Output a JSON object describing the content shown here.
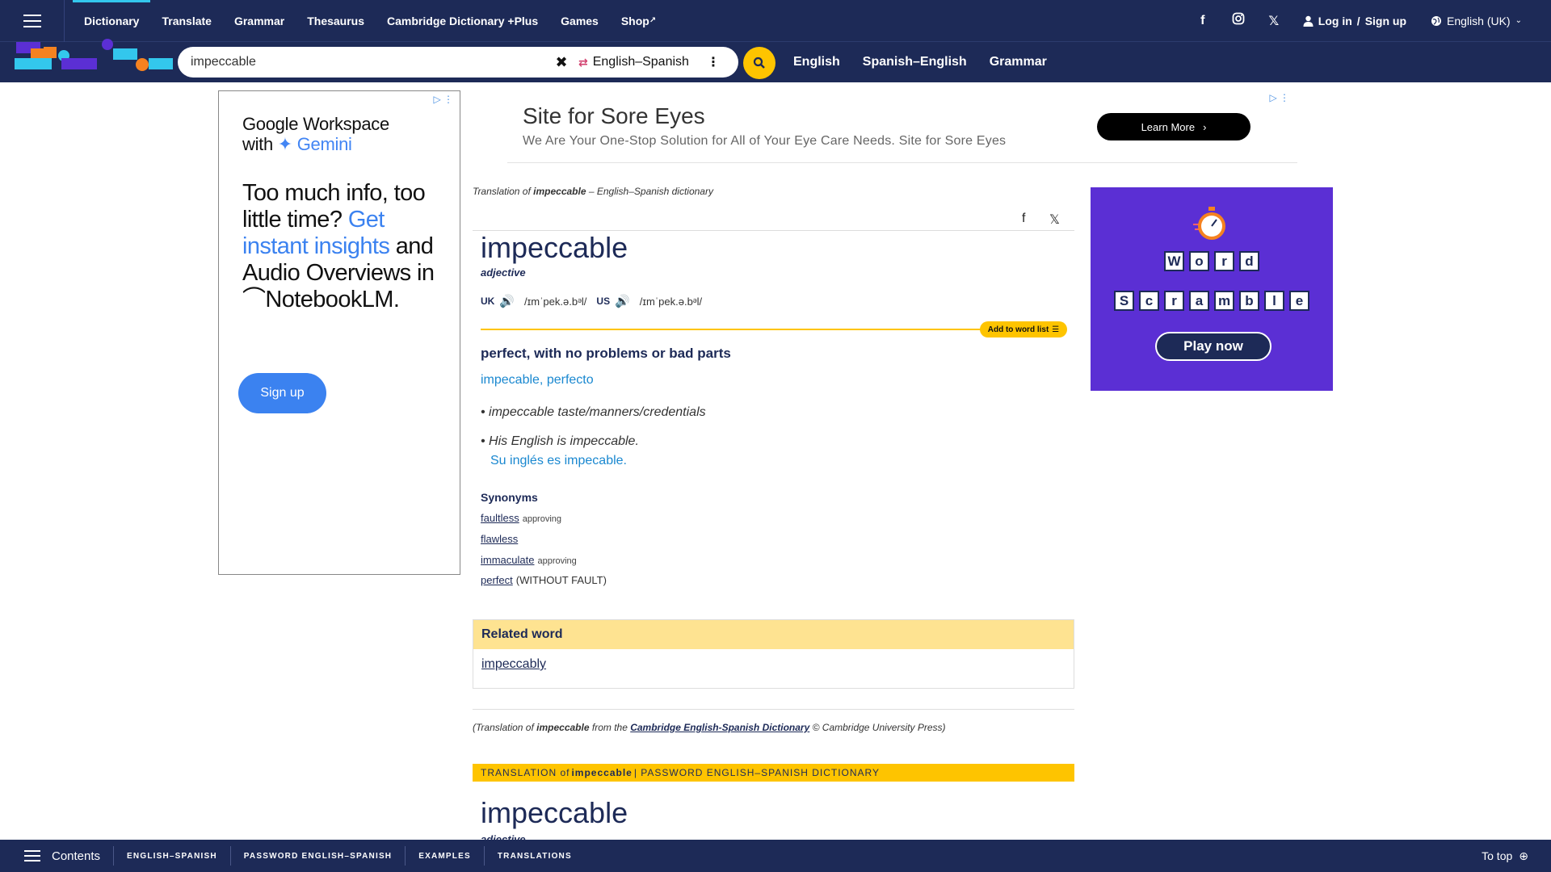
{
  "topnav": {
    "items": [
      "Dictionary",
      "Translate",
      "Grammar",
      "Thesaurus",
      "Cambridge Dictionary +Plus",
      "Games",
      "Shop"
    ],
    "login_label": "Log in",
    "signup_label": "Sign up",
    "language": "English (UK)"
  },
  "search": {
    "value": "impeccable",
    "dictionary": "English–Spanish",
    "subnav": [
      "English",
      "Spanish–English",
      "Grammar"
    ]
  },
  "ad_left": {
    "line1": "Google Workspace",
    "line2a": "with",
    "line2b": "Gemini",
    "h_a": "Too much info, too little time?",
    "h_b": "Get instant insights",
    "h_c": "and Audio Overviews in",
    "h_d": "NotebookLM.",
    "button": "Sign up"
  },
  "ad_top": {
    "title": "Site for Sore Eyes",
    "subtitle": "We Are Your One-Stop Solution for All of Your Eye Care Needs. Site for Sore Eyes",
    "button": "Learn More"
  },
  "entry": {
    "breadcrumb_pre": "Translation of ",
    "breadcrumb_word": "impeccable",
    "breadcrumb_post": " – English–Spanish dictionary",
    "headword": "impeccable",
    "pos": "adjective",
    "uk_label": "UK",
    "uk_ipa": "/ɪmˈpek.ə.bᵊl/",
    "us_label": "US",
    "us_ipa": "/ɪmˈpek.ə.bᵊl/",
    "add_to_list": "Add to word list",
    "definition": "perfect, with no problems or bad parts",
    "translation": "impecable, perfecto",
    "example1": "impeccable taste/manners/credentials",
    "example2": "His English is impeccable.",
    "example2_translation": "Su inglés es impecable.",
    "synonyms_heading": "Synonyms",
    "synonyms": [
      {
        "word": "faultless",
        "note": "approving"
      },
      {
        "word": "flawless",
        "note": ""
      },
      {
        "word": "immaculate",
        "note": "approving"
      },
      {
        "word": "perfect",
        "note": "(WITHOUT FAULT)"
      }
    ],
    "related_heading": "Related word",
    "related_word": "impeccably",
    "credit_pre": "(Translation of ",
    "credit_word": "impeccable",
    "credit_mid": " from the ",
    "credit_source": "Cambridge English-Spanish Dictionary",
    "credit_post": " © Cambridge University Press)",
    "pw_pre": "TRANSLATION of ",
    "pw_word": "impeccable",
    "pw_post": " | PASSWORD ENGLISH–SPANISH DICTIONARY",
    "headword2": "impeccable",
    "pos2": "adjective"
  },
  "ad_right": {
    "row1": [
      "W",
      "o",
      "r",
      "d"
    ],
    "row2": [
      "S",
      "c",
      "r",
      "a",
      "m",
      "b",
      "l",
      "e"
    ],
    "button": "Play now"
  },
  "bottombar": {
    "contents": "Contents",
    "links": [
      "ENGLISH–SPANISH",
      "PASSWORD ENGLISH–SPANISH",
      "EXAMPLES",
      "TRANSLATIONS"
    ],
    "totop": "To top"
  }
}
